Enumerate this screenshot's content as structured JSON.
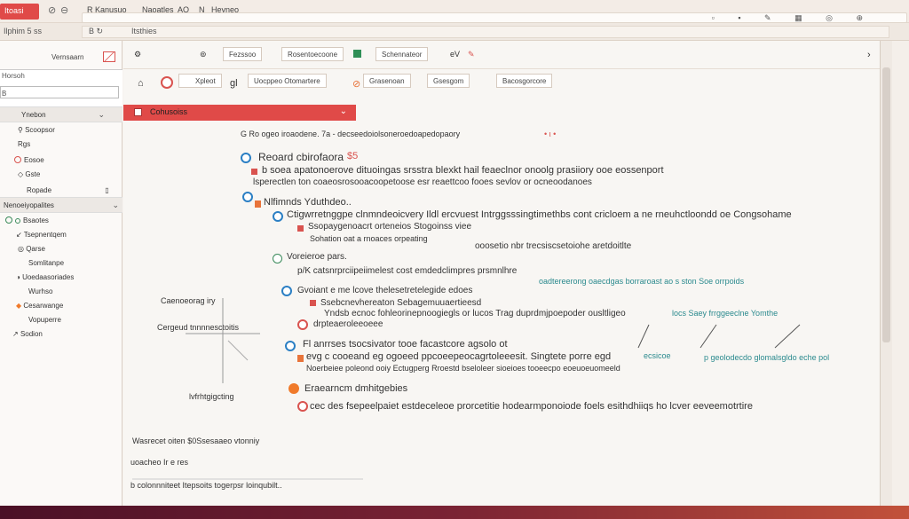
{
  "titlebar": {
    "tab_label": "Itoasi",
    "item1": "R Kanusuo",
    "item2": "Naoatles",
    "item3": "AO",
    "item4": "N",
    "item5": "Heyneo"
  },
  "toolbar2": {
    "left": "Ilphim  5 ss",
    "mid": "Itsthies"
  },
  "sidebar": {
    "head_label": "Vernsaarn",
    "search_placeholder": "Horsoh",
    "search_value": "B",
    "group1_label": "Ynebon",
    "items": [
      {
        "label": "Scoopsor"
      },
      {
        "label": "Rgs"
      },
      {
        "label": "Eosoe"
      },
      {
        "label": "Gste"
      },
      {
        "label": "Ropade"
      }
    ],
    "group2_label": "Nenoeiyopalites",
    "items2": [
      {
        "label": "Bsaotes"
      },
      {
        "label": "Tsepnentqem"
      },
      {
        "label": "Qarse"
      },
      {
        "label": "Somlitanpe"
      },
      {
        "label": "Uoedaasoriades"
      },
      {
        "label": "Wurhso"
      },
      {
        "label": "Cesarwange"
      },
      {
        "label": "Vopuperre"
      },
      {
        "label": "Sodion"
      }
    ]
  },
  "main": {
    "toolbar": {
      "b1": "Fezssoo",
      "b2": "Rosentoecoone",
      "b3": "Schennateor",
      "b4": "eV"
    },
    "tools": {
      "t1": "Xpleot",
      "t2": "Uocppeo Otomartere",
      "t3": "Grasenoan",
      "t4": "Gsesgom",
      "t5": "Bacosgorcore"
    },
    "banner": "Cohusoiss",
    "lines": {
      "l0": "G Ro ogeo iroaodene. 7a - decseedoiolsoneroedoapedopaory",
      "l1a": "Reoard cbirofaora",
      "l1a_num": "$5",
      "l1b": "b soea apatonoerove dituoingas srsstra blexkt hail  feaeclnor onoolg prasiiory  ooe eossenport",
      "l1c": "lsperectlen ton coaeosrosooacoopetoose esr reaettcoo fooes sevlov or ocneoodanoes",
      "l2a": "Nlfimnds Yduthdeo..",
      "l2b": "Ctigwrretnggpe clnmndeoicvery Ildl ercvuest Intrggsssingtimethbs cont cricloem  a  ne rneuhctloondd  oe Congsohame",
      "l2b_num": "a",
      "l2c": "Ssopaygenoacrt orteneios  Stogoinss viee",
      "l2d": "Sohation oat a  rnoaces orpeating",
      "l2e": "ooosetio nbr trecsiscsetoiohe aretdoitlte",
      "l3a": "Voreieroe pars.",
      "l3b": "p/K catsnrprciipeiimelest cost emdedclimpres prsmnlhre",
      "l3c": "oadtereerong oaecdgas borraroast ao  s ston Soe orrpoids",
      "l4a": "Gvoiant e me lcove  thelesetretelegide edoes",
      "l4b": "Ssebcnevhereaton Sebagemuuaertieesd",
      "l4c": "Yndsb ecnoc  fohleorinepnoogiegls  or lucos Trag  duprdmjpoepoder ousltligeo",
      "l4d": "locs Saey frrggeeclne  Yomthe",
      "l5a": "drpteaeroleeoeee",
      "l6a": "Fl anrrses tsocsivator tooe  facastcore agsolo ot",
      "l6b": "evg c  cooeand eg ogoeed  ppcoeepeocagrtoleeesit.  Singtete porre  egd",
      "l6c": "ecsicoe",
      "l6d": "p geolodecdo  glomalsgldo  eche pol",
      "l6e": "Noerbeiee poleond  ooiy Ectugperg  Rroestd  bseloleer  sioeioes  tooeecpo  eoeuoeuomeeld",
      "l7a": "Eraearncm dmhitgebies",
      "l8a": "cec des fsepeelpaiet  estdeceleoe prorcetitie hodearmponoiode foels esithdhiiqs  ho lcver  eeveemotrtire",
      "footer1": "Wasrecet oiten $0Ssesaaeo vtonniy",
      "footer2": "uoacheo Ir  e res",
      "footer3": "b  colonnniteet Itepsoits togerpsr loinqubilt..",
      "side_label1": "Caenoeorag iry",
      "side_label2": "Cergeud tnnnnesctoitis",
      "side_label3": "lvfrhtgigcting"
    }
  },
  "colors": {
    "accent_red": "#e04a48",
    "teal": "#2b8a8e",
    "orange": "#f07a2a",
    "blue": "#2b7fc4"
  }
}
